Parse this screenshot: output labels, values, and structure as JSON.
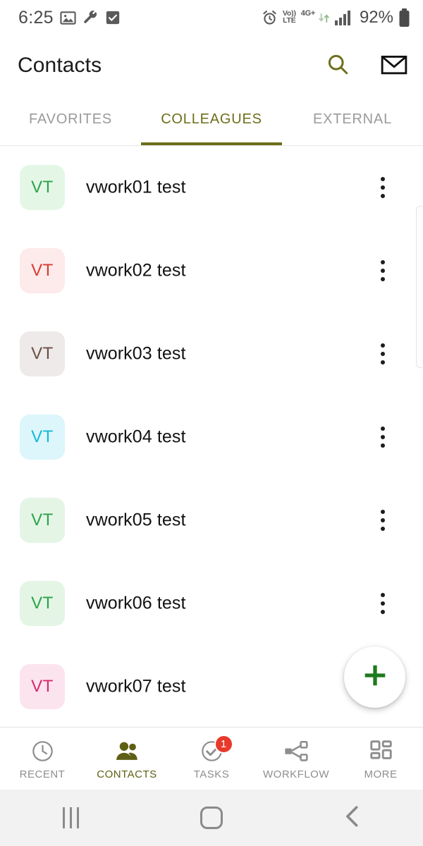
{
  "status_bar": {
    "time": "6:25",
    "left_icons": [
      "image-icon",
      "wrench-icon",
      "checkbox-icon"
    ],
    "alarm_icon": "alarm-icon",
    "volte_top": "Vo))",
    "volte_bottom": "LTE",
    "network": "4G+",
    "data_arrows": "data-transfer-icon",
    "signal_icon": "signal-bars-icon",
    "battery_percent": "92%",
    "battery_icon": "battery-full-icon"
  },
  "app_bar": {
    "title": "Contacts",
    "search_icon": "search-icon",
    "mail_icon": "mail-icon"
  },
  "tabs": [
    {
      "label": "FAVORITES",
      "active": false
    },
    {
      "label": "COLLEAGUES",
      "active": true
    },
    {
      "label": "EXTERNAL",
      "active": false
    }
  ],
  "contacts": [
    {
      "initials": "VT",
      "name": "vwork01 test",
      "bg": "#e4f7e6",
      "fg": "#2ea34a"
    },
    {
      "initials": "VT",
      "name": "vwork02 test",
      "bg": "#fdeaea",
      "fg": "#d93a34"
    },
    {
      "initials": "VT",
      "name": "vwork03 test",
      "bg": "#eeeaea",
      "fg": "#6b4f46"
    },
    {
      "initials": "VT",
      "name": "vwork04 test",
      "bg": "#dcf6fb",
      "fg": "#17b8d6"
    },
    {
      "initials": "VT",
      "name": "vwork05 test",
      "bg": "#e4f5e6",
      "fg": "#2ea34a"
    },
    {
      "initials": "VT",
      "name": "vwork06 test",
      "bg": "#e4f5e6",
      "fg": "#2ea34a"
    },
    {
      "initials": "VT",
      "name": "vwork07 test",
      "bg": "#fce4ef",
      "fg": "#d62a6e"
    }
  ],
  "fab": {
    "icon": "plus-icon",
    "color": "#1e7a1e"
  },
  "bottom_nav": [
    {
      "label": "RECENT",
      "icon": "clock-icon",
      "active": false,
      "badge": null
    },
    {
      "label": "CONTACTS",
      "icon": "people-icon",
      "active": true,
      "badge": null
    },
    {
      "label": "TASKS",
      "icon": "check-circle-icon",
      "active": false,
      "badge": "1"
    },
    {
      "label": "WORKFLOW",
      "icon": "share-nodes-icon",
      "active": false,
      "badge": null
    },
    {
      "label": "MORE",
      "icon": "grid-icon",
      "active": false,
      "badge": null
    }
  ],
  "android_nav": [
    {
      "name": "recents-button",
      "icon": "recents-icon"
    },
    {
      "name": "home-button",
      "icon": "home-icon"
    },
    {
      "name": "back-button",
      "icon": "back-chevron-icon"
    }
  ],
  "theme": {
    "accent_olive": "#6e6e1a",
    "badge_red": "#e8392b",
    "fab_green": "#1e7a1e"
  }
}
